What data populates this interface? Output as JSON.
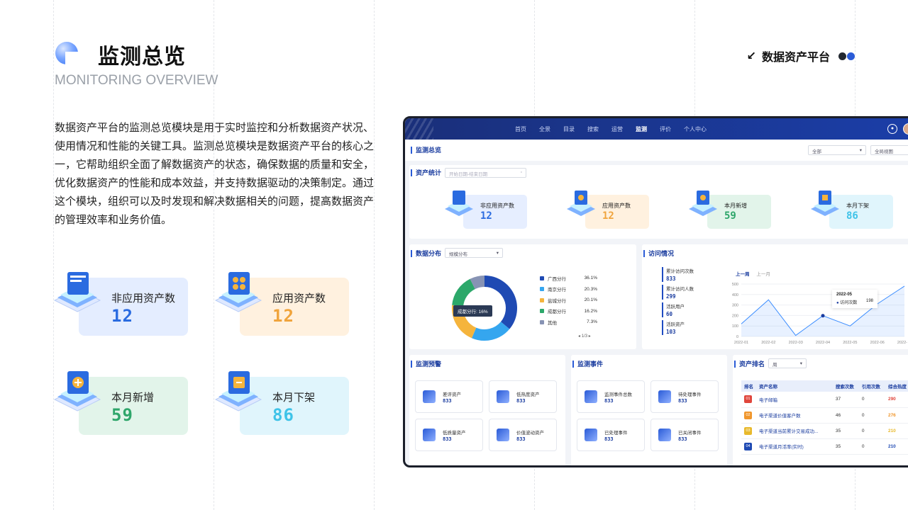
{
  "header": {
    "title": "监测总览",
    "subtitle": "MONITORING OVERVIEW",
    "brand": "数据资产平台",
    "brand_arrow": "↙",
    "dot_colors": [
      "#222831",
      "#2a5bd7"
    ]
  },
  "intro": "数据资产平台的监测总览模块是用于实时监控和分析数据资产状况、使用情况和性能的关键工具。监测总览模块是数据资产平台的核心之一，它帮助组织全面了解数据资产的状态，确保数据的质量和安全，优化数据资产的性能和成本效益，并支持数据驱动的决策制定。通过这个模块，组织可以及时发现和解决数据相关的问题，提高数据资产的管理效率和业务价值。",
  "cards": [
    {
      "label": "非应用资产数",
      "value": "12",
      "color": "#2a6be0",
      "bg": "#e4edff"
    },
    {
      "label": "应用资产数",
      "value": "12",
      "color": "#f0a43c",
      "bg": "#fff1df"
    },
    {
      "label": "本月新增",
      "value": "59",
      "color": "#2fa66b",
      "bg": "#e2f4ea"
    },
    {
      "label": "本月下架",
      "value": "86",
      "color": "#3fc3e8",
      "bg": "#e0f5fc"
    }
  ],
  "mock": {
    "nav": [
      "首页",
      "全景",
      "目录",
      "搜索",
      "运营",
      "监测",
      "评价",
      "个人中心"
    ],
    "page_title": "监测总览",
    "filter1": "全部",
    "filter2": "全局视图",
    "asset_stats": {
      "title": "资产统计",
      "date_placeholder": "开始日期-结束日期",
      "items": [
        {
          "label": "非应用资产数",
          "value": "12"
        },
        {
          "label": "应用资产数",
          "value": "12"
        },
        {
          "label": "本月新增",
          "value": "59"
        },
        {
          "label": "本月下架",
          "value": "86"
        }
      ]
    },
    "distribution": {
      "title": "数据分布",
      "select": "规模分布",
      "tooltip": "成都分行: 16%",
      "pager": "1/3",
      "legend": [
        {
          "name": "广西分行",
          "pct": "36.1%",
          "color": "#1f4ab3"
        },
        {
          "name": "南京分行",
          "pct": "20.3%",
          "color": "#35a6ef"
        },
        {
          "name": "盐城分行",
          "pct": "20.1%",
          "color": "#f5b43c"
        },
        {
          "name": "成都分行",
          "pct": "16.2%",
          "color": "#2ca86a"
        },
        {
          "name": "其他",
          "pct": "7.3%",
          "color": "#8793b4"
        }
      ]
    },
    "visits": {
      "title": "访问情况",
      "tab_active": "上一周",
      "tab_other": "上一月",
      "kpis": [
        {
          "label": "累计访问次数",
          "value": "833"
        },
        {
          "label": "累计访问人数",
          "value": "299"
        },
        {
          "label": "活跃用户",
          "value": "60"
        },
        {
          "label": "活跃资产",
          "value": "103"
        }
      ],
      "tooltip_date": "2022-05",
      "tooltip_label": "访问次数",
      "tooltip_value": "198",
      "chart": {
        "x": [
          "2022-01",
          "2022-02",
          "2022-03",
          "2022-04",
          "2022-05",
          "2022-06",
          "2022-07"
        ],
        "yticks": [
          "0",
          "100",
          "200",
          "300",
          "400",
          "500"
        ],
        "values": [
          120,
          350,
          10,
          198,
          100,
          310,
          480
        ],
        "ylim": [
          0,
          500
        ]
      }
    },
    "alerts": {
      "title": "监测预警",
      "items": [
        {
          "label": "差评资产",
          "value": "833"
        },
        {
          "label": "低热度资产",
          "value": "833"
        },
        {
          "label": "低质量资产",
          "value": "833"
        },
        {
          "label": "价值波动资产",
          "value": "833"
        }
      ]
    },
    "events": {
      "title": "监测事件",
      "items": [
        {
          "label": "监测事件总数",
          "value": "833"
        },
        {
          "label": "待处理事件",
          "value": "833"
        },
        {
          "label": "已处理事件",
          "value": "833"
        },
        {
          "label": "已关闭事件",
          "value": "833"
        }
      ]
    },
    "ranking": {
      "title": "资产排名",
      "select": "周",
      "columns": [
        "排名",
        "资产名称",
        "搜索次数",
        "引用次数",
        "综合热度"
      ],
      "rows": [
        {
          "rank": "01",
          "name": "电子邮箱",
          "search": "37",
          "ref": "0",
          "heat": "290",
          "color": "#e0463c"
        },
        {
          "rank": "02",
          "name": "电子渠道价值客户数",
          "search": "46",
          "ref": "0",
          "heat": "276",
          "color": "#f0962c"
        },
        {
          "rank": "03",
          "name": "电子渠道当前累计交易成功...",
          "search": "35",
          "ref": "0",
          "heat": "210",
          "color": "#e8b92c"
        },
        {
          "rank": "04",
          "name": "电子渠道月活率(实时)",
          "search": "35",
          "ref": "0",
          "heat": "210",
          "color": "#1f4ab3"
        }
      ]
    }
  }
}
